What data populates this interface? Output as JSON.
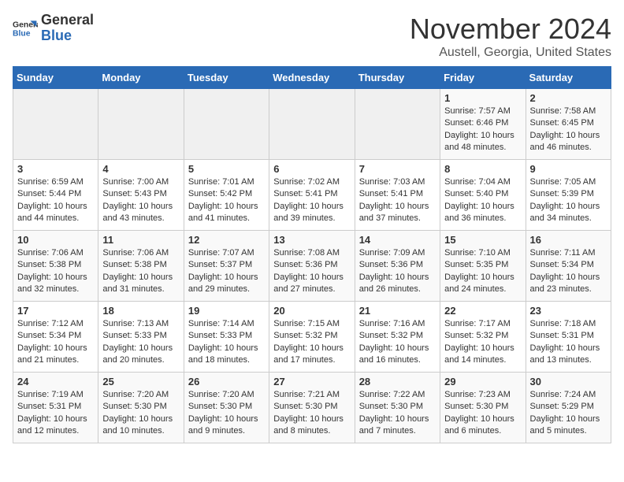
{
  "logo": {
    "general": "General",
    "blue": "Blue"
  },
  "header": {
    "month": "November 2024",
    "location": "Austell, Georgia, United States"
  },
  "weekdays": [
    "Sunday",
    "Monday",
    "Tuesday",
    "Wednesday",
    "Thursday",
    "Friday",
    "Saturday"
  ],
  "weeks": [
    [
      {
        "day": "",
        "info": ""
      },
      {
        "day": "",
        "info": ""
      },
      {
        "day": "",
        "info": ""
      },
      {
        "day": "",
        "info": ""
      },
      {
        "day": "",
        "info": ""
      },
      {
        "day": "1",
        "info": "Sunrise: 7:57 AM\nSunset: 6:46 PM\nDaylight: 10 hours and 48 minutes."
      },
      {
        "day": "2",
        "info": "Sunrise: 7:58 AM\nSunset: 6:45 PM\nDaylight: 10 hours and 46 minutes."
      }
    ],
    [
      {
        "day": "3",
        "info": "Sunrise: 6:59 AM\nSunset: 5:44 PM\nDaylight: 10 hours and 44 minutes."
      },
      {
        "day": "4",
        "info": "Sunrise: 7:00 AM\nSunset: 5:43 PM\nDaylight: 10 hours and 43 minutes."
      },
      {
        "day": "5",
        "info": "Sunrise: 7:01 AM\nSunset: 5:42 PM\nDaylight: 10 hours and 41 minutes."
      },
      {
        "day": "6",
        "info": "Sunrise: 7:02 AM\nSunset: 5:41 PM\nDaylight: 10 hours and 39 minutes."
      },
      {
        "day": "7",
        "info": "Sunrise: 7:03 AM\nSunset: 5:41 PM\nDaylight: 10 hours and 37 minutes."
      },
      {
        "day": "8",
        "info": "Sunrise: 7:04 AM\nSunset: 5:40 PM\nDaylight: 10 hours and 36 minutes."
      },
      {
        "day": "9",
        "info": "Sunrise: 7:05 AM\nSunset: 5:39 PM\nDaylight: 10 hours and 34 minutes."
      }
    ],
    [
      {
        "day": "10",
        "info": "Sunrise: 7:06 AM\nSunset: 5:38 PM\nDaylight: 10 hours and 32 minutes."
      },
      {
        "day": "11",
        "info": "Sunrise: 7:06 AM\nSunset: 5:38 PM\nDaylight: 10 hours and 31 minutes."
      },
      {
        "day": "12",
        "info": "Sunrise: 7:07 AM\nSunset: 5:37 PM\nDaylight: 10 hours and 29 minutes."
      },
      {
        "day": "13",
        "info": "Sunrise: 7:08 AM\nSunset: 5:36 PM\nDaylight: 10 hours and 27 minutes."
      },
      {
        "day": "14",
        "info": "Sunrise: 7:09 AM\nSunset: 5:36 PM\nDaylight: 10 hours and 26 minutes."
      },
      {
        "day": "15",
        "info": "Sunrise: 7:10 AM\nSunset: 5:35 PM\nDaylight: 10 hours and 24 minutes."
      },
      {
        "day": "16",
        "info": "Sunrise: 7:11 AM\nSunset: 5:34 PM\nDaylight: 10 hours and 23 minutes."
      }
    ],
    [
      {
        "day": "17",
        "info": "Sunrise: 7:12 AM\nSunset: 5:34 PM\nDaylight: 10 hours and 21 minutes."
      },
      {
        "day": "18",
        "info": "Sunrise: 7:13 AM\nSunset: 5:33 PM\nDaylight: 10 hours and 20 minutes."
      },
      {
        "day": "19",
        "info": "Sunrise: 7:14 AM\nSunset: 5:33 PM\nDaylight: 10 hours and 18 minutes."
      },
      {
        "day": "20",
        "info": "Sunrise: 7:15 AM\nSunset: 5:32 PM\nDaylight: 10 hours and 17 minutes."
      },
      {
        "day": "21",
        "info": "Sunrise: 7:16 AM\nSunset: 5:32 PM\nDaylight: 10 hours and 16 minutes."
      },
      {
        "day": "22",
        "info": "Sunrise: 7:17 AM\nSunset: 5:32 PM\nDaylight: 10 hours and 14 minutes."
      },
      {
        "day": "23",
        "info": "Sunrise: 7:18 AM\nSunset: 5:31 PM\nDaylight: 10 hours and 13 minutes."
      }
    ],
    [
      {
        "day": "24",
        "info": "Sunrise: 7:19 AM\nSunset: 5:31 PM\nDaylight: 10 hours and 12 minutes."
      },
      {
        "day": "25",
        "info": "Sunrise: 7:20 AM\nSunset: 5:30 PM\nDaylight: 10 hours and 10 minutes."
      },
      {
        "day": "26",
        "info": "Sunrise: 7:20 AM\nSunset: 5:30 PM\nDaylight: 10 hours and 9 minutes."
      },
      {
        "day": "27",
        "info": "Sunrise: 7:21 AM\nSunset: 5:30 PM\nDaylight: 10 hours and 8 minutes."
      },
      {
        "day": "28",
        "info": "Sunrise: 7:22 AM\nSunset: 5:30 PM\nDaylight: 10 hours and 7 minutes."
      },
      {
        "day": "29",
        "info": "Sunrise: 7:23 AM\nSunset: 5:30 PM\nDaylight: 10 hours and 6 minutes."
      },
      {
        "day": "30",
        "info": "Sunrise: 7:24 AM\nSunset: 5:29 PM\nDaylight: 10 hours and 5 minutes."
      }
    ]
  ]
}
